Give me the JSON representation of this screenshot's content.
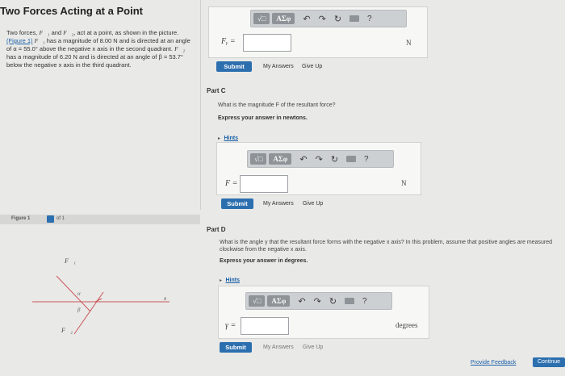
{
  "page_title": "Two Forces Acting at a Point",
  "problem": {
    "line1": "Two forces,",
    "f1": "F⃗₁",
    "and": "and",
    "f2": "F⃗₂",
    "line1b": ", act at a point, as shown in the picture.",
    "figure_link": "(Figure 1)",
    "line2": "has a magnitude of 8.00 N and is directed at an angle of α = 55.0° above the negative x axis in the second quadrant.",
    "line3": "has a magnitude of 6.20 N and is directed at an angle of β = 53.7° below the negative x axis in the third quadrant."
  },
  "toolbar": {
    "templates_label": "√□",
    "symbols_label": "AΣφ",
    "undo": "↶",
    "redo": "↷",
    "reset": "↻",
    "help": "?"
  },
  "part_b": {
    "var_label": "Fᵧ =",
    "input_value": "",
    "unit": "N",
    "submit": "Submit",
    "my_answers": "My Answers",
    "give_up": "Give Up"
  },
  "part_c": {
    "label": "Part C",
    "question": "What is the magnitude F of the resultant force?",
    "instruction": "Express your answer in newtons.",
    "hints": "Hints",
    "var_label": "F =",
    "input_value": "",
    "unit": "N",
    "submit": "Submit",
    "my_answers": "My Answers",
    "give_up": "Give Up"
  },
  "part_d": {
    "label": "Part D",
    "question": "What is the angle γ that the resultant force forms with the negative x axis? In this problem, assume that positive angles are measured clockwise from the negative x axis.",
    "instruction": "Express your answer in degrees.",
    "hints": "Hints",
    "var_label": "γ =",
    "input_value": "",
    "unit": "degrees",
    "submit": "Submit",
    "my_answers": "My Answers",
    "give_up": "Give Up"
  },
  "figure": {
    "label": "Figure 1",
    "of": "of 1",
    "f1_label": "F⃗₁",
    "f2_label": "F⃗₂",
    "alpha": "α",
    "beta": "β",
    "x_label": "x"
  },
  "footer": {
    "feedback": "Provide Feedback",
    "continue": "Continue"
  },
  "colors": {
    "accent": "#2c6faf",
    "toolbar_bg": "#cdd0d3",
    "page_bg": "#e9e9e7"
  }
}
